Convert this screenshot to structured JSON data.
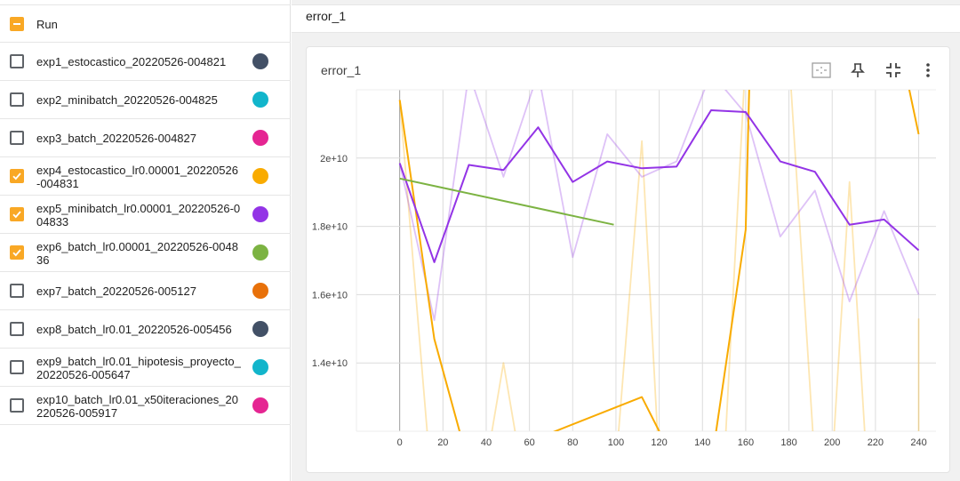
{
  "run_list": {
    "header_label": "Run",
    "runs": [
      {
        "label": "exp1_estocastico_20220526-004821",
        "checked": false,
        "color": "#425066"
      },
      {
        "label": "exp2_minibatch_20220526-004825",
        "checked": false,
        "color": "#12b5cb"
      },
      {
        "label": "exp3_batch_20220526-004827",
        "checked": false,
        "color": "#e52592"
      },
      {
        "label": "exp4_estocastico_lr0.00001_20220526-004831",
        "checked": true,
        "color": "#f9ab00"
      },
      {
        "label": "exp5_minibatch_lr0.00001_20220526-004833",
        "checked": true,
        "color": "#9334e6"
      },
      {
        "label": "exp6_batch_lr0.00001_20220526-004836",
        "checked": true,
        "color": "#7cb342"
      },
      {
        "label": "exp7_batch_20220526-005127",
        "checked": false,
        "color": "#e8710a"
      },
      {
        "label": "exp8_batch_lr0.01_20220526-005456",
        "checked": false,
        "color": "#425066"
      },
      {
        "label": "exp9_batch_lr0.01_hipotesis_proyecto_20220526-005647",
        "checked": false,
        "color": "#12b5cb"
      },
      {
        "label": "exp10_batch_lr0.01_x50iteraciones_20220526-005917",
        "checked": false,
        "color": "#e52592"
      }
    ]
  },
  "group": {
    "title": "error_1"
  },
  "card": {
    "title": "error_1",
    "icons": [
      "fit-domain-icon",
      "pin-icon",
      "fullscreen-exit-icon",
      "more-vert-icon"
    ]
  },
  "chart_data": {
    "type": "line",
    "title": "error_1",
    "xlim": [
      -20,
      248
    ],
    "ylim": [
      12000000000.0,
      22000000000.0
    ],
    "x_ticks": [
      0,
      20,
      40,
      60,
      80,
      100,
      120,
      140,
      160,
      180,
      200,
      220,
      240
    ],
    "y_ticks": [
      14000000000.0,
      16000000000.0,
      18000000000.0,
      20000000000.0
    ],
    "y_tick_labels": [
      "1.4e+10",
      "1.6e+10",
      "1.8e+10",
      "2e+10"
    ],
    "grid": true,
    "series": [
      {
        "color": "#f9ab00",
        "smoothed": [
          [
            0,
            21700000000.0
          ],
          [
            16,
            14700000000.0
          ],
          [
            32,
            11000000000.0
          ],
          [
            112,
            13000000000.0
          ],
          [
            128,
            11000000000.0
          ],
          [
            144,
            11000000000.0
          ],
          [
            160,
            17900000000.0
          ],
          [
            162,
            23000000000.0
          ],
          [
            234,
            22500000000.0
          ],
          [
            240,
            20700000000.0
          ]
        ],
        "raw": [
          [
            0,
            21700000000.0
          ],
          [
            14,
            11000000000.0
          ],
          [
            40,
            11000000000.0
          ],
          [
            48,
            14000000000.0
          ],
          [
            56,
            11000000000.0
          ],
          [
            100,
            11000000000.0
          ],
          [
            112,
            20500000000.0
          ],
          [
            120,
            11000000000.0
          ],
          [
            150,
            11000000000.0
          ],
          [
            160,
            23000000000.0
          ],
          [
            180,
            23000000000.0
          ],
          [
            192,
            11000000000.0
          ],
          [
            200,
            11000000000.0
          ],
          [
            208,
            19300000000.0
          ],
          [
            216,
            11000000000.0
          ],
          [
            240,
            11000000000.0
          ],
          [
            240,
            15300000000.0
          ]
        ]
      },
      {
        "color": "#9334e6",
        "smoothed": [
          [
            0,
            19850000000.0
          ],
          [
            16,
            16950000000.0
          ],
          [
            32,
            19800000000.0
          ],
          [
            48,
            19650000000.0
          ],
          [
            64,
            20900000000.0
          ],
          [
            80,
            19300000000.0
          ],
          [
            96,
            19900000000.0
          ],
          [
            112,
            19700000000.0
          ],
          [
            128,
            19750000000.0
          ],
          [
            144,
            21400000000.0
          ],
          [
            160,
            21350000000.0
          ],
          [
            176,
            19900000000.0
          ],
          [
            192,
            19600000000.0
          ],
          [
            208,
            18050000000.0
          ],
          [
            224,
            18200000000.0
          ],
          [
            240,
            17300000000.0
          ]
        ],
        "raw": [
          [
            0,
            19850000000.0
          ],
          [
            16,
            15250000000.0
          ],
          [
            32,
            22500000000.0
          ],
          [
            48,
            19450000000.0
          ],
          [
            64,
            22500000000.0
          ],
          [
            80,
            17100000000.0
          ],
          [
            96,
            20700000000.0
          ],
          [
            112,
            19450000000.0
          ],
          [
            128,
            19900000000.0
          ],
          [
            144,
            22500000000.0
          ],
          [
            160,
            21300000000.0
          ],
          [
            176,
            17700000000.0
          ],
          [
            192,
            19050000000.0
          ],
          [
            208,
            15800000000.0
          ],
          [
            224,
            18450000000.0
          ],
          [
            240,
            16000000000.0
          ]
        ]
      },
      {
        "color": "#7cb342",
        "smoothed": [
          [
            0,
            19400000000.0
          ],
          [
            99,
            18050000000.0
          ]
        ]
      }
    ]
  }
}
